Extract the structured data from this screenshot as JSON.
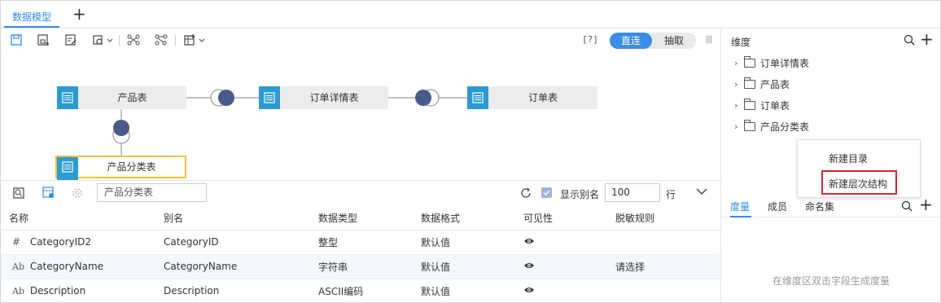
{
  "tabs": {
    "active_label": "数据模型",
    "add_label": "+"
  },
  "toolbar": {
    "help_label": "[?]",
    "mode_direct": "直连",
    "mode_extract": "抽取"
  },
  "canvas": {
    "nodes": {
      "product": "产品表",
      "order_detail": "订单详情表",
      "order": "订单表",
      "category": "产品分类表"
    }
  },
  "field_panel": {
    "search_value": "产品分类表",
    "show_alias_label": "显示别名",
    "rows_value": "100",
    "rows_unit": "行",
    "columns": [
      "名称",
      "别名",
      "数据类型",
      "数据格式",
      "可见性",
      "脱敏规则"
    ],
    "rows": [
      {
        "type_icon": "#",
        "name": "CategoryID2",
        "alias": "CategoryID",
        "data_type": "整型",
        "format": "默认值",
        "masking": ""
      },
      {
        "type_icon": "Ab",
        "name": "CategoryName",
        "alias": "CategoryName",
        "data_type": "字符串",
        "format": "默认值",
        "masking": "请选择"
      },
      {
        "type_icon": "Ab",
        "name": "Description",
        "alias": "Description",
        "data_type": "ASCII编码",
        "format": "默认值",
        "masking": ""
      }
    ]
  },
  "dimension_panel": {
    "title": "维度",
    "add_label": "+",
    "items": [
      "订单详情表",
      "产品表",
      "订单表",
      "产品分类表"
    ]
  },
  "context_menu": {
    "new_folder": "新建目录",
    "new_hierarchy": "新建层次结构"
  },
  "measure_panel": {
    "tabs": [
      "度量",
      "成员",
      "命名集"
    ],
    "add_label": "+",
    "hint": "在维度区双击字段生成度量"
  },
  "colors": {
    "accent": "#2d8cf0",
    "node_icon": "#2b9bd3",
    "join_dot": "#4a5a8c",
    "highlight": "#d9282f"
  }
}
